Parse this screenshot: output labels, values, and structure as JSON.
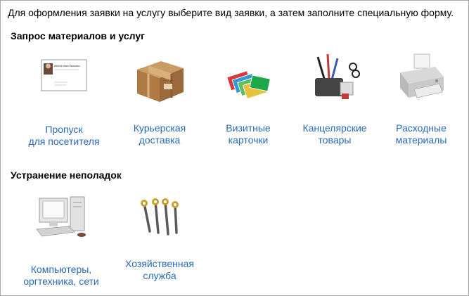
{
  "intro_text": "Для оформления заявки на услугу выберите вид заявки, а затем заполните специальную форму.",
  "sections": [
    {
      "title": "Запрос материалов и услуг",
      "items": [
        {
          "line1": "Пропуск",
          "line2": "для посетителя",
          "icon": "business-card-icon",
          "card_text": "Иванов Иван Иванович"
        },
        {
          "line1": "Курьерская",
          "line2": "доставка",
          "icon": "parcel-box-icon"
        },
        {
          "line1": "Визитные",
          "line2": "карточки",
          "icon": "business-cards-stack-icon"
        },
        {
          "line1": "Канцелярские",
          "line2": "товары",
          "icon": "office-supplies-icon"
        },
        {
          "line1": "Расходные",
          "line2": "материалы",
          "icon": "printer-icon"
        }
      ]
    },
    {
      "title": "Устранение неполадок",
      "items": [
        {
          "line1": "Компьютеры,",
          "line2": "оргтехника, сети",
          "icon": "computer-icon"
        },
        {
          "line1": "Хозяйственная",
          "line2": "служба",
          "icon": "wrenches-icon"
        }
      ]
    }
  ],
  "colors": {
    "link": "#2a6ab3",
    "border": "#a7a7a7"
  }
}
